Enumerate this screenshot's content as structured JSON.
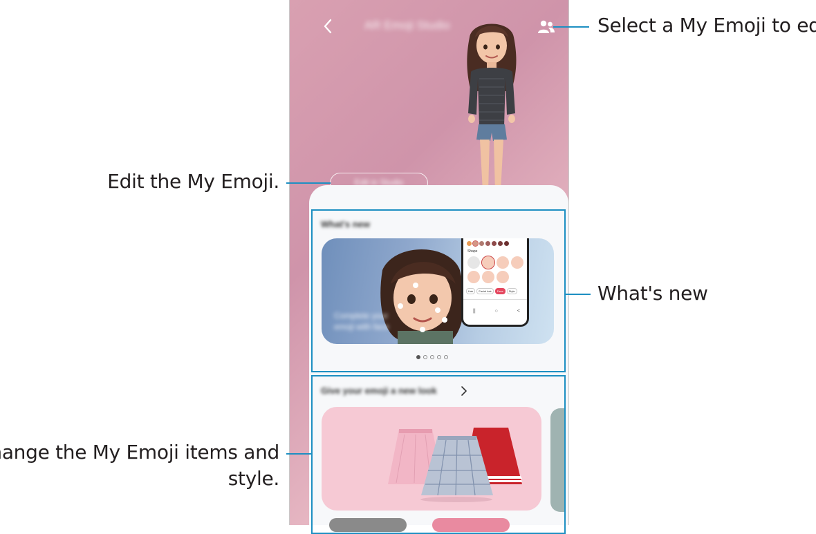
{
  "app": {
    "title": "AR Emoji Studio",
    "edit_button_label": "Edit in Studio",
    "whats_new_title": "What's new",
    "banner_text_line1": "Complete your",
    "banner_text_line2": "emoji with face",
    "section_title": "Give your emoji a new look",
    "pagination": {
      "current": 1,
      "total": 5
    },
    "accent_color": "#1d8fc2",
    "mini_phone": {
      "shape_label": "Shape",
      "tabs": [
        "Hair",
        "Facial hair",
        "Face",
        "Style"
      ]
    },
    "icons": {
      "back": "chevron-left-icon",
      "select_emoji": "people-icon",
      "section_more": "chevron-right-icon"
    }
  },
  "annotations": {
    "select_emoji": "Select a My Emoji to edit.",
    "edit_emoji": "Edit the My Emoji.",
    "whats_new": "What's new",
    "change_items_line1": "Change the My Emoji items and",
    "change_items_line2": "style."
  }
}
